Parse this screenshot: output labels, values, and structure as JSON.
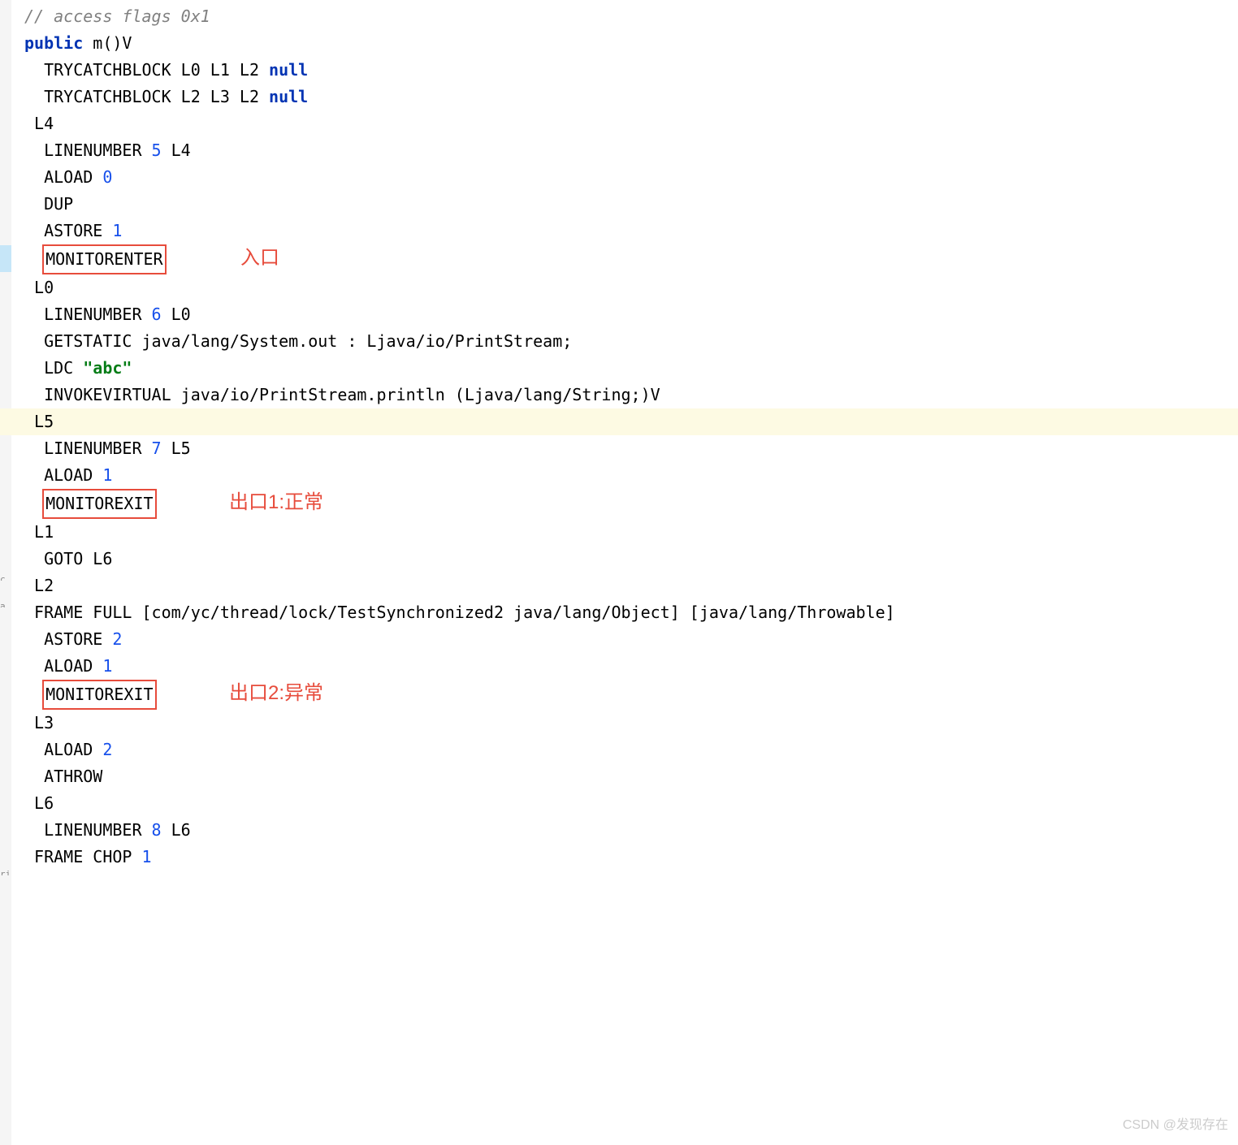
{
  "code": {
    "l1_comment": "// access flags 0x1",
    "l2_keyword": "public",
    "l2_rest": " m()V",
    "l3_pre": "  TRYCATCHBLOCK L0 L1 L2 ",
    "l3_null": "null",
    "l4_pre": "  TRYCATCHBLOCK L2 L3 L2 ",
    "l4_null": "null",
    "l5": " L4",
    "l6_pre": "  LINENUMBER ",
    "l6_num": "5",
    "l6_post": " L4",
    "l7_pre": "  ALOAD ",
    "l7_num": "0",
    "l8": "  DUP",
    "l9_pre": "  ASTORE ",
    "l9_num": "1",
    "l10_box": "MONITORENTER",
    "l11": " L0",
    "l12_pre": "  LINENUMBER ",
    "l12_num": "6",
    "l12_post": " L0",
    "l13": "  GETSTATIC java/lang/System.out : Ljava/io/PrintStream;",
    "l14_pre": "  LDC ",
    "l14_str": "\"abc\"",
    "l15": "  INVOKEVIRTUAL java/io/PrintStream.println (Ljava/lang/String;)V",
    "l16": " L5",
    "l17_pre": "  LINENUMBER ",
    "l17_num": "7",
    "l17_post": " L5",
    "l18_pre": "  ALOAD ",
    "l18_num": "1",
    "l19_box": "MONITOREXIT",
    "l20": " L1",
    "l21": "  GOTO L6",
    "l22": " L2",
    "l23": " FRAME FULL [com/yc/thread/lock/TestSynchronized2 java/lang/Object] [java/lang/Throwable]",
    "l24_pre": "  ASTORE ",
    "l24_num": "2",
    "l25_pre": "  ALOAD ",
    "l25_num": "1",
    "l26_box": "MONITOREXIT",
    "l27": " L3",
    "l28_pre": "  ALOAD ",
    "l28_num": "2",
    "l29": "  ATHROW",
    "l30": " L6",
    "l31_pre": "  LINENUMBER ",
    "l31_num": "8",
    "l31_post": " L6",
    "l32_pre": " FRAME CHOP ",
    "l32_num": "1"
  },
  "annotations": {
    "entry": "入口",
    "exit1": "出口1:正常",
    "exit2": "出口2:异常"
  },
  "watermark": "CSDN @发现存在"
}
